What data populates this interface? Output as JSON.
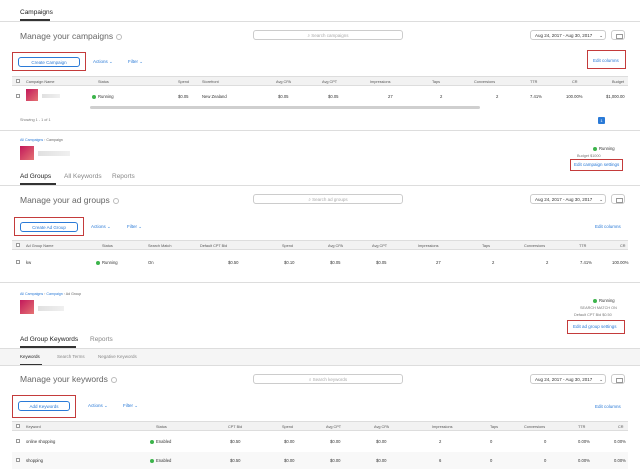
{
  "campaigns": {
    "tab": "Campaigns",
    "heading": "Manage your campaigns",
    "search_placeholder": "Search campaigns",
    "date_range": "Aug 24, 2017 - Aug 30, 2017",
    "create_label": "Create Campaign",
    "actions_label": "Actions",
    "filter_label": "Filter",
    "edit_columns": "Edit columns",
    "columns": [
      "Campaign Name",
      "Status",
      "Spend",
      "Storefront",
      "Avg CPA",
      "Avg CPT",
      "Impressions",
      "Taps",
      "Conversions",
      "TTR",
      "CR",
      "Budget"
    ],
    "row": {
      "status": "Running",
      "spend": "$0.05",
      "storefront": "New Zealand",
      "avg_cpa": "$0.05",
      "avg_cpt": "$0.05",
      "impressions": "27",
      "taps": "2",
      "conversions": "2",
      "ttr": "7.41%",
      "cr": "100.00%",
      "budget": "$1,000.00"
    },
    "showing": "Showing 1 - 1 of 1",
    "page": "1"
  },
  "campaign_detail": {
    "breadcrumb": [
      "All Campaigns",
      "Campaign"
    ],
    "status": "Running",
    "budget_line": "Budget $1000",
    "settings_link": "Edit campaign settings",
    "tabs": [
      "Ad Groups",
      "All Keywords",
      "Reports"
    ],
    "heading": "Manage your ad groups",
    "search_placeholder": "Search ad groups",
    "date_range": "Aug 24, 2017 - Aug 30, 2017",
    "create_label": "Create Ad Group",
    "actions_label": "Actions",
    "filter_label": "Filter",
    "edit_columns": "Edit columns",
    "columns": [
      "Ad Group Name",
      "Status",
      "Search Match",
      "Default CPT Bid",
      "Spend",
      "Avg CPA",
      "Avg CPT",
      "Impressions",
      "Taps",
      "Conversions",
      "TTR",
      "CR"
    ],
    "row": {
      "name": "kw",
      "status": "Running",
      "search_match": "On",
      "default_cpt_bid": "$0.50",
      "spend": "$0.10",
      "avg_cpa": "$0.05",
      "avg_cpt": "$0.05",
      "impressions": "27",
      "taps": "2",
      "conversions": "2",
      "ttr": "7.41%",
      "cr": "100.00%"
    }
  },
  "adgroup_detail": {
    "breadcrumb": [
      "All Campaigns",
      "Campaign",
      "Ad Group"
    ],
    "status": "Running",
    "search_match_line": "SEARCH MATCH ON",
    "cpt_bid_line": "Default CPT Bid $0.50",
    "settings_link": "Edit ad group settings",
    "tabs": [
      "Ad Group Keywords",
      "Reports"
    ],
    "subtabs": [
      "Keywords",
      "Search Terms",
      "Negative Keywords"
    ],
    "heading": "Manage your keywords",
    "search_placeholder": "Search keywords",
    "date_range": "Aug 24, 2017 - Aug 30, 2017",
    "create_label": "Add Keywords",
    "actions_label": "Actions",
    "filter_label": "Filter",
    "edit_columns": "Edit columns",
    "columns": [
      "Keyword",
      "Status",
      "CPT Bid",
      "Spend",
      "Avg CPT",
      "Avg CPA",
      "Impressions",
      "Taps",
      "Conversions",
      "TTR",
      "CR"
    ],
    "rows": [
      {
        "keyword": "online shopping",
        "status": "Enabled",
        "cpt_bid": "$0.50",
        "spend": "$0.00",
        "avg_cpt": "$0.00",
        "avg_cpa": "$0.00",
        "impressions": "2",
        "taps": "0",
        "conversions": "0",
        "ttr": "0.00%",
        "cr": "0.00%"
      },
      {
        "keyword": "shopping",
        "status": "Enabled",
        "cpt_bid": "$0.50",
        "spend": "$0.00",
        "avg_cpt": "$0.00",
        "avg_cpa": "$0.00",
        "impressions": "6",
        "taps": "0",
        "conversions": "0",
        "ttr": "0.00%",
        "cr": "0.00%"
      }
    ]
  },
  "colors": {
    "accent": "#2a7ad7",
    "highlight": "#c43b3b",
    "running": "#3cb44b"
  }
}
